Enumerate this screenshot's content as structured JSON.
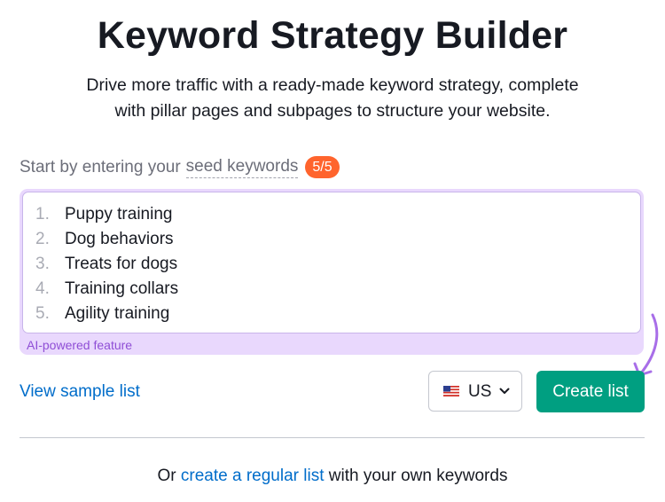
{
  "header": {
    "title": "Keyword Strategy Builder",
    "subtitle_line1": "Drive more traffic with a ready-made keyword strategy, complete",
    "subtitle_line2": "with pillar pages and subpages to structure your website."
  },
  "seed": {
    "label_prefix": "Start by entering your",
    "label_link": "seed keywords",
    "count_badge": "5/5"
  },
  "keywords": [
    {
      "num": "1.",
      "text": "Puppy training"
    },
    {
      "num": "2.",
      "text": "Dog behaviors"
    },
    {
      "num": "3.",
      "text": "Treats for dogs"
    },
    {
      "num": "4.",
      "text": "Training collars"
    },
    {
      "num": "5.",
      "text": "Agility training"
    }
  ],
  "ai_label": "AI-powered feature",
  "actions": {
    "sample_link": "View sample list",
    "country": "US",
    "country_flag_icon": "us-flag-icon",
    "create_button": "Create list"
  },
  "footer": {
    "prefix": "Or",
    "link": "create a regular list",
    "suffix": "with your own keywords"
  },
  "colors": {
    "accent_green": "#009f81",
    "badge_orange": "#ff642d",
    "ai_purple_bg": "#e9d8fd",
    "ai_purple_text": "#8f4ed6",
    "link_blue": "#006dca"
  }
}
